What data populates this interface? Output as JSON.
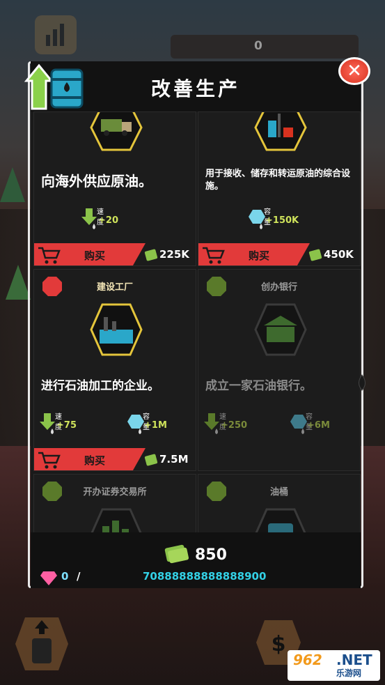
{
  "top_counter": "0",
  "panel": {
    "title": "改善生产",
    "close_label": "✕"
  },
  "cards": [
    {
      "name": "",
      "desc": "向海外供应原油。",
      "stats": [
        {
          "label": "速度",
          "value": "+20",
          "kind": "speed"
        }
      ],
      "buy_label": "购买",
      "price": "225K",
      "locked": false
    },
    {
      "name": "",
      "desc": "用于接收、储存和转运原油的综合设施。",
      "stats": [
        {
          "label": "容量",
          "value": "+150K",
          "kind": "capacity"
        }
      ],
      "buy_label": "购买",
      "price": "450K",
      "locked": false
    },
    {
      "name": "建设工厂",
      "desc": "进行石油加工的企业。",
      "stats": [
        {
          "label": "速度",
          "value": "+75",
          "kind": "speed"
        },
        {
          "label": "容量",
          "value": "+1M",
          "kind": "capacity"
        }
      ],
      "buy_label": "购买",
      "price": "7.5M",
      "locked": false
    },
    {
      "name": "创办银行",
      "desc": "成立一家石油银行。",
      "stats": [
        {
          "label": "速度",
          "value": "+250",
          "kind": "speed"
        },
        {
          "label": "容量",
          "value": "+6M",
          "kind": "capacity"
        }
      ],
      "locked": true
    },
    {
      "name": "开办证券交易所",
      "locked": true
    },
    {
      "name": "油桶",
      "locked": true
    }
  ],
  "footer": {
    "money": "850",
    "gems": "0",
    "gems_sep": "/",
    "long_number": "70888888888888900"
  },
  "watermark": {
    "brand": "962",
    "net": ".NET",
    "cn": "乐游网"
  },
  "colors": {
    "buy_red": "#e23a3a",
    "price_green": "#8bc34a",
    "stat_green": "#cfe35b",
    "cyan": "#33d1e6"
  }
}
